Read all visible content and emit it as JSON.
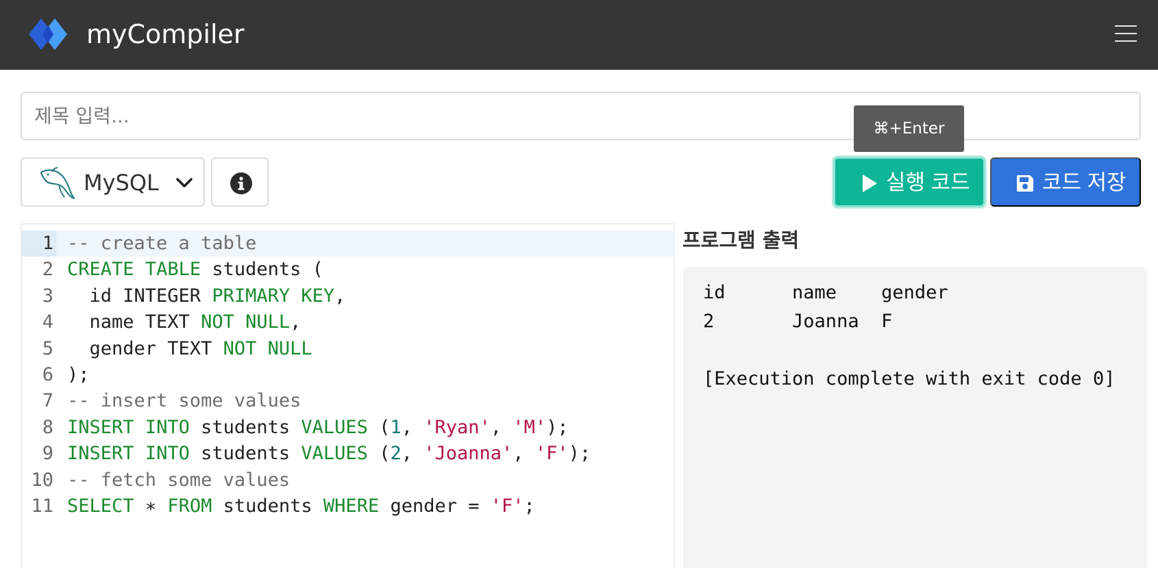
{
  "navbar": {
    "brand": "myCompiler",
    "logo_icon": "diamond-logo-icon",
    "menu_icon": "hamburger-menu-icon"
  },
  "title_input": {
    "placeholder": "제목 입력...",
    "value": ""
  },
  "toolbar": {
    "language": "MySQL",
    "language_icon": "mysql-dolphin-icon",
    "info_icon": "info-circle-icon",
    "run_label": "실행 코드",
    "run_shortcut_tooltip": "⌘+Enter",
    "save_label": "코드 저장"
  },
  "editor": {
    "active_line": 1,
    "lines": [
      {
        "n": "1",
        "tokens": [
          {
            "t": "-- create a table",
            "c": "comment"
          }
        ]
      },
      {
        "n": "2",
        "tokens": [
          {
            "t": "CREATE",
            "c": "kw"
          },
          {
            "t": " ",
            "c": "plain"
          },
          {
            "t": "TABLE",
            "c": "kw"
          },
          {
            "t": " students (",
            "c": "plain"
          }
        ]
      },
      {
        "n": "3",
        "tokens": [
          {
            "t": "  id INTEGER ",
            "c": "plain"
          },
          {
            "t": "PRIMARY",
            "c": "kw"
          },
          {
            "t": " ",
            "c": "plain"
          },
          {
            "t": "KEY",
            "c": "kw"
          },
          {
            "t": ",",
            "c": "plain"
          }
        ]
      },
      {
        "n": "4",
        "tokens": [
          {
            "t": "  name TEXT ",
            "c": "plain"
          },
          {
            "t": "NOT",
            "c": "kw"
          },
          {
            "t": " ",
            "c": "plain"
          },
          {
            "t": "NULL",
            "c": "kw"
          },
          {
            "t": ",",
            "c": "plain"
          }
        ]
      },
      {
        "n": "5",
        "tokens": [
          {
            "t": "  gender TEXT ",
            "c": "plain"
          },
          {
            "t": "NOT",
            "c": "kw"
          },
          {
            "t": " ",
            "c": "plain"
          },
          {
            "t": "NULL",
            "c": "kw"
          }
        ]
      },
      {
        "n": "6",
        "tokens": [
          {
            "t": ");",
            "c": "plain"
          }
        ]
      },
      {
        "n": "7",
        "tokens": [
          {
            "t": "-- insert some values",
            "c": "comment"
          }
        ]
      },
      {
        "n": "8",
        "tokens": [
          {
            "t": "INSERT",
            "c": "kw"
          },
          {
            "t": " ",
            "c": "plain"
          },
          {
            "t": "INTO",
            "c": "kw"
          },
          {
            "t": " students ",
            "c": "plain"
          },
          {
            "t": "VALUES",
            "c": "kw"
          },
          {
            "t": " (",
            "c": "plain"
          },
          {
            "t": "1",
            "c": "num"
          },
          {
            "t": ", ",
            "c": "plain"
          },
          {
            "t": "'Ryan'",
            "c": "str"
          },
          {
            "t": ", ",
            "c": "plain"
          },
          {
            "t": "'M'",
            "c": "str"
          },
          {
            "t": ");",
            "c": "plain"
          }
        ]
      },
      {
        "n": "9",
        "tokens": [
          {
            "t": "INSERT",
            "c": "kw"
          },
          {
            "t": " ",
            "c": "plain"
          },
          {
            "t": "INTO",
            "c": "kw"
          },
          {
            "t": " students ",
            "c": "plain"
          },
          {
            "t": "VALUES",
            "c": "kw"
          },
          {
            "t": " (",
            "c": "plain"
          },
          {
            "t": "2",
            "c": "num"
          },
          {
            "t": ", ",
            "c": "plain"
          },
          {
            "t": "'Joanna'",
            "c": "str"
          },
          {
            "t": ", ",
            "c": "plain"
          },
          {
            "t": "'F'",
            "c": "str"
          },
          {
            "t": ");",
            "c": "plain"
          }
        ]
      },
      {
        "n": "10",
        "tokens": [
          {
            "t": "-- fetch some values",
            "c": "comment"
          }
        ]
      },
      {
        "n": "11",
        "tokens": [
          {
            "t": "SELECT",
            "c": "kw"
          },
          {
            "t": " ∗ ",
            "c": "plain"
          },
          {
            "t": "FROM",
            "c": "kw"
          },
          {
            "t": " students ",
            "c": "plain"
          },
          {
            "t": "WHERE",
            "c": "kw"
          },
          {
            "t": " gender = ",
            "c": "plain"
          },
          {
            "t": "'F'",
            "c": "str"
          },
          {
            "t": ";",
            "c": "plain"
          }
        ]
      }
    ]
  },
  "output": {
    "title": "프로그램 출력",
    "lines": [
      "id      name    gender",
      "2       Joanna  F",
      "",
      "[Execution complete with exit code 0]"
    ]
  },
  "colors": {
    "navbar_bg": "#363636",
    "run_button": "#0eb597",
    "save_button": "#2f73dc",
    "keyword": "#1b8a2e",
    "string": "#b3134c",
    "number": "#0f7a76",
    "comment": "#6e6e6e"
  }
}
